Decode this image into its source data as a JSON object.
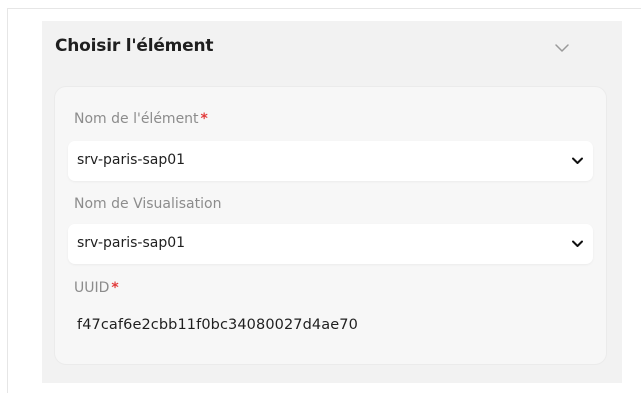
{
  "panel": {
    "title": "Choisir l'élément",
    "toggle_icon": "chevron-down-icon"
  },
  "fields": {
    "element_name": {
      "label": "Nom de l'élément",
      "required_mark": "*",
      "value": "srv-paris-sap01",
      "icon": "chevron-down-icon"
    },
    "display_name": {
      "label": "Nom de Visualisation",
      "value": "srv-paris-sap01",
      "icon": "chevron-down-icon"
    },
    "uuid": {
      "label": "UUID",
      "required_mark": "*",
      "value": "f47caf6e2cbb11f0bc34080027d4ae70"
    }
  },
  "colors": {
    "panel_background": "#f2f2f2",
    "card_background": "#f7f7f7",
    "required": "#e23a3a",
    "label_text": "#8c8c8c",
    "value_text": "#1f1f1f"
  }
}
